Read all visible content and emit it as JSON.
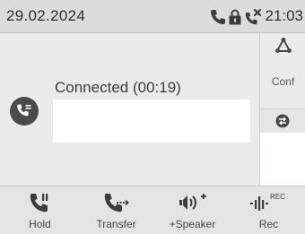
{
  "status_bar": {
    "date": "29.02.2024",
    "time": "21:03",
    "icons": [
      "phone-icon",
      "lock-icon",
      "missed-call-icon"
    ]
  },
  "call": {
    "status": "Connected (00:19)",
    "avatar_icon": "call-hold-avatar-icon"
  },
  "side_buttons": {
    "conf_label": "Conf",
    "conf_icon": "conference-icon",
    "swap_icon": "swap-icon"
  },
  "softkeys": [
    {
      "label": "Hold",
      "icon": "hold-icon"
    },
    {
      "label": "Transfer",
      "icon": "transfer-icon"
    },
    {
      "label": "+Speaker",
      "icon": "speaker-icon"
    },
    {
      "label": "Rec",
      "icon": "record-icon"
    }
  ],
  "colors": {
    "status_bar_bg": "#dcdcdc",
    "main_bg": "#ebebeb",
    "icon_dark": "#3c3c3c"
  }
}
